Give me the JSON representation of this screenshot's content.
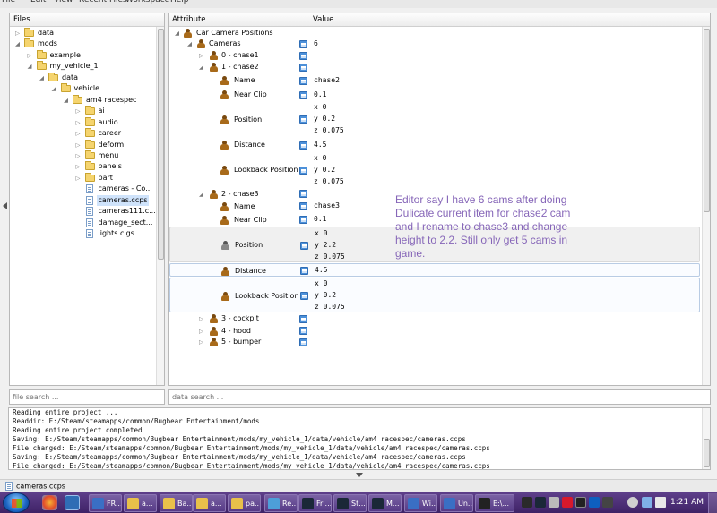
{
  "menu": [
    "File",
    "Edit",
    "View",
    "Recent Files",
    "Workspace",
    "Help"
  ],
  "files_panel": {
    "header": "Files",
    "tree": [
      {
        "label": "data",
        "type": "folder",
        "arrow": "▷"
      },
      {
        "label": "mods",
        "type": "folder",
        "arrow": "◢"
      },
      {
        "label": "example",
        "type": "folder",
        "arrow": "▷"
      },
      {
        "label": "my_vehicle_1",
        "type": "folder",
        "arrow": "◢"
      },
      {
        "label": "data",
        "type": "folder",
        "arrow": "◢"
      },
      {
        "label": "vehicle",
        "type": "folder",
        "arrow": "◢"
      },
      {
        "label": "am4 racespec",
        "type": "folder",
        "arrow": "◢"
      },
      {
        "label": "ai",
        "type": "folder",
        "arrow": "▷"
      },
      {
        "label": "audio",
        "type": "folder",
        "arrow": "▷"
      },
      {
        "label": "career",
        "type": "folder",
        "arrow": "▷"
      },
      {
        "label": "deform",
        "type": "folder",
        "arrow": "▷"
      },
      {
        "label": "menu",
        "type": "folder",
        "arrow": "▷"
      },
      {
        "label": "panels",
        "type": "folder",
        "arrow": "▷"
      },
      {
        "label": "part",
        "type": "folder",
        "arrow": "▷"
      },
      {
        "label": "cameras - Co...",
        "type": "file",
        "arrow": ""
      },
      {
        "label": "cameras.ccps",
        "type": "file",
        "arrow": "",
        "selected": true
      },
      {
        "label": "cameras111.c...",
        "type": "file",
        "arrow": ""
      },
      {
        "label": "damage_sect...",
        "type": "file",
        "arrow": ""
      },
      {
        "label": "lights.clgs",
        "type": "file",
        "arrow": ""
      }
    ],
    "search_placeholder": "file search ..."
  },
  "attr_panel": {
    "col_attribute": "Attribute",
    "col_value": "Value",
    "rows": [
      {
        "label": "Car Camera Positions",
        "arrow": "◢",
        "edit": false,
        "value": []
      },
      {
        "label": "Cameras",
        "arrow": "◢",
        "edit": true,
        "value": [
          "6"
        ]
      },
      {
        "label": "0 - chase1",
        "arrow": "▷",
        "edit": true,
        "value": []
      },
      {
        "label": "1 - chase2",
        "arrow": "◢",
        "edit": true,
        "value": []
      },
      {
        "label": "Name",
        "arrow": "",
        "edit": true,
        "value": [
          "chase2"
        ]
      },
      {
        "label": "Near Clip",
        "arrow": "",
        "edit": true,
        "value": [
          "0.1"
        ]
      },
      {
        "label": "Position",
        "arrow": "",
        "edit": true,
        "value": [
          "x 0",
          "y 0.2",
          "z 0.075"
        ]
      },
      {
        "label": "Distance",
        "arrow": "",
        "edit": true,
        "value": [
          "4.5"
        ]
      },
      {
        "label": "Lookback Position",
        "arrow": "",
        "edit": true,
        "value": [
          "x 0",
          "y 0.2",
          "z 0.075"
        ]
      },
      {
        "label": "2 - chase3",
        "arrow": "◢",
        "edit": true,
        "value": []
      },
      {
        "label": "Name",
        "arrow": "",
        "edit": true,
        "value": [
          "chase3"
        ]
      },
      {
        "label": "Near Clip",
        "arrow": "",
        "edit": true,
        "value": [
          "0.1"
        ]
      },
      {
        "label": "Position",
        "arrow": "",
        "edit": true,
        "value": [
          "x 0",
          "y 2.2",
          "z 0.075"
        ]
      },
      {
        "label": "Distance",
        "arrow": "",
        "edit": true,
        "value": [
          "4.5"
        ]
      },
      {
        "label": "Lookback Position",
        "arrow": "",
        "edit": true,
        "value": [
          "x 0",
          "y 0.2",
          "z 0.075"
        ]
      },
      {
        "label": "3 - cockpit",
        "arrow": "▷",
        "edit": true,
        "value": []
      },
      {
        "label": "4 - hood",
        "arrow": "▷",
        "edit": true,
        "value": []
      },
      {
        "label": "5 - bumper",
        "arrow": "▷",
        "edit": true,
        "value": []
      }
    ],
    "search_placeholder": "data search ..."
  },
  "annotation": "Editor say I have 6 cams after doing Dulicate current item for chase2 cam and I rename to chase3 and change height to 2.2. Still only get 5 cams in game.",
  "log": [
    "Reading entire project ...",
    "Readdir: E:/Steam/steamapps/common/Bugbear Entertainment/mods",
    "Reading entire project completed",
    "Saving: E:/Steam/steamapps/common/Bugbear Entertainment/mods/my_vehicle_1/data/vehicle/am4 racespec/cameras.ccps",
    "File changed: E:/Steam/steamapps/common/Bugbear Entertainment/mods/my_vehicle_1/data/vehicle/am4 racespec/cameras.ccps",
    "Saving: E:/Steam/steamapps/common/Bugbear Entertainment/mods/my_vehicle_1/data/vehicle/am4 racespec/cameras.ccps",
    "File changed: E:/Steam/steamapps/common/Bugbear Entertainment/mods/my_vehicle_1/data/vehicle/am4 racespec/cameras.ccps"
  ],
  "status": {
    "file": "cameras.ccps"
  },
  "taskbar": {
    "tasks": [
      {
        "label": "FR...",
        "color": "#3a6fc4"
      },
      {
        "label": "a...",
        "color": "#e8c04a"
      },
      {
        "label": "Ba...",
        "color": "#e8c04a"
      },
      {
        "label": "a...",
        "color": "#e8c04a"
      },
      {
        "label": "pa...",
        "color": "#e8c04a"
      },
      {
        "label": "Re...",
        "color": "#4d9ed9"
      },
      {
        "label": "Fri...",
        "color": "#1b2838"
      },
      {
        "label": "St...",
        "color": "#1b2838"
      },
      {
        "label": "M...",
        "color": "#1b2838"
      },
      {
        "label": "Wi...",
        "color": "#3a6fc4"
      },
      {
        "label": "Un...",
        "color": "#3a6fc4"
      },
      {
        "label": "E:\\...",
        "color": "#222222"
      }
    ],
    "clock": "1:21 AM"
  }
}
